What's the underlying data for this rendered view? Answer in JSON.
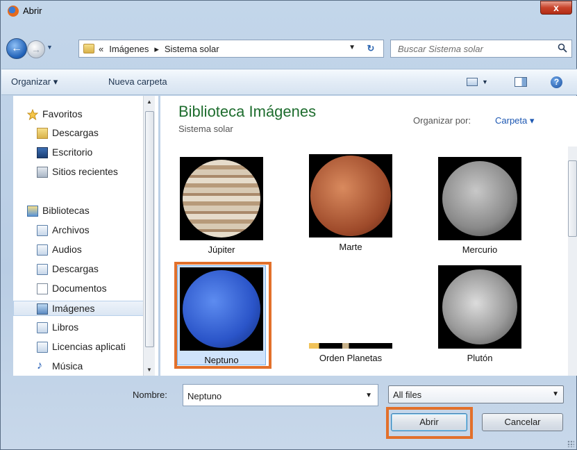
{
  "window": {
    "title": "Abrir",
    "close_label": "x"
  },
  "address": {
    "prefix": "«",
    "crumbs": [
      "Imágenes",
      "Sistema solar"
    ],
    "separator": "▸",
    "search_placeholder": "Buscar Sistema solar"
  },
  "toolbar": {
    "organize": "Organizar ▾",
    "new_folder": "Nueva carpeta",
    "help": "?"
  },
  "navpane": {
    "items": [
      {
        "label": "Favoritos",
        "icon": "star-icon",
        "indent": 0
      },
      {
        "label": "Descargas",
        "icon": "downloads-folder-icon",
        "indent": 1
      },
      {
        "label": "Escritorio",
        "icon": "desktop-icon",
        "indent": 1
      },
      {
        "label": "Sitios recientes",
        "icon": "recent-places-icon",
        "indent": 1
      },
      {
        "label": "Bibliotecas",
        "icon": "libraries-icon",
        "indent": 0
      },
      {
        "label": "Archivos",
        "icon": "library-icon",
        "indent": 1
      },
      {
        "label": "Audios",
        "icon": "library-icon",
        "indent": 1
      },
      {
        "label": "Descargas",
        "icon": "library-icon",
        "indent": 1
      },
      {
        "label": "Documentos",
        "icon": "documents-icon",
        "indent": 1
      },
      {
        "label": "Imágenes",
        "icon": "pictures-icon",
        "indent": 1,
        "selected": true
      },
      {
        "label": "Libros",
        "icon": "library-icon",
        "indent": 1
      },
      {
        "label": "Licencias aplicati",
        "icon": "library-icon",
        "indent": 1
      },
      {
        "label": "Música",
        "icon": "music-icon",
        "indent": 1
      }
    ]
  },
  "main": {
    "library_title": "Biblioteca Imágenes",
    "library_subtitle": "Sistema solar",
    "sort_label": "Organizar por:",
    "sort_value": "Carpeta ▾",
    "files": [
      {
        "name": "Júpiter",
        "color": "#c9b9a2",
        "selected": false
      },
      {
        "name": "Marte",
        "color": "#b8613c",
        "selected": false
      },
      {
        "name": "Mercurio",
        "color": "#8f8f8f",
        "selected": false
      },
      {
        "name": "Neptuno",
        "color": "#2f5fd8",
        "selected": true
      },
      {
        "name": "Orden Planetas",
        "color": "#e8b04a",
        "selected": false
      },
      {
        "name": "Plutón",
        "color": "#bcbcbc",
        "selected": false
      }
    ]
  },
  "footer": {
    "name_label": "Nombre:",
    "name_value": "Neptuno",
    "filter_value": "All files",
    "open_label": "Abrir",
    "cancel_label": "Cancelar"
  },
  "colors": {
    "highlight": "#e2702b",
    "title_green": "#1e6d2e",
    "link_blue": "#1c57b2"
  }
}
